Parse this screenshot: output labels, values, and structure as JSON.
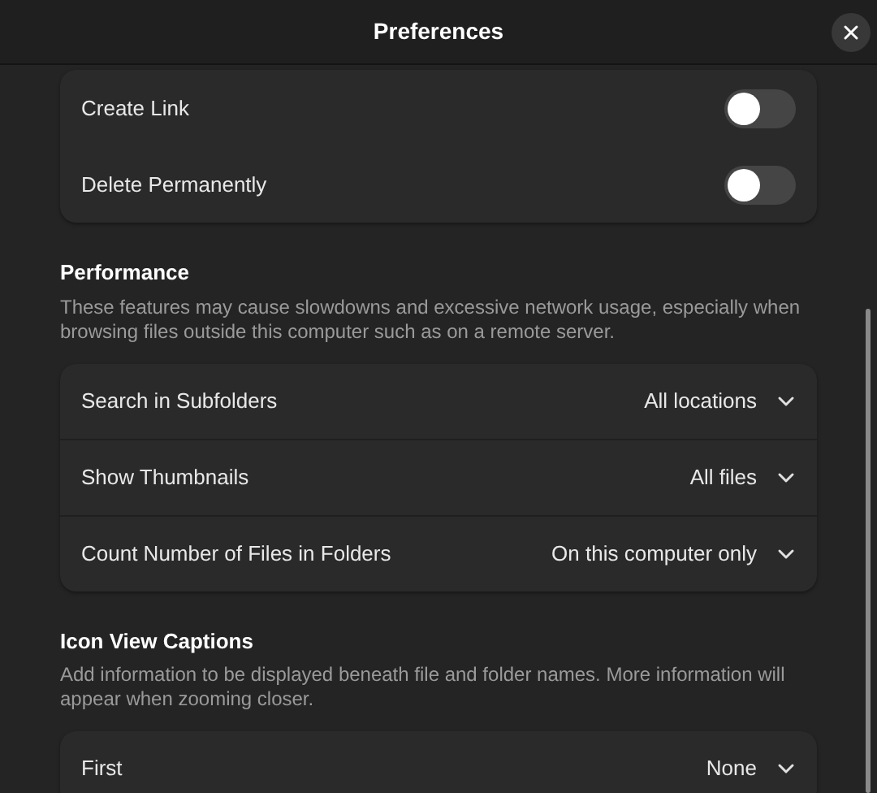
{
  "window": {
    "title": "Preferences"
  },
  "toggles": [
    {
      "label": "Create Link",
      "on": false
    },
    {
      "label": "Delete Permanently",
      "on": false
    }
  ],
  "sections": [
    {
      "title": "Performance",
      "description": "These features may cause slowdowns and excessive network usage, especially when browsing files outside this computer such as on a remote server.",
      "rows": [
        {
          "label": "Search in Subfolders",
          "value": "All locations"
        },
        {
          "label": "Show Thumbnails",
          "value": "All files"
        },
        {
          "label": "Count Number of Files in Folders",
          "value": "On this computer only"
        }
      ]
    },
    {
      "title": "Icon View Captions",
      "description": "Add information to be displayed beneath file and folder names. More information will appear when zooming closer.",
      "rows": [
        {
          "label": "First",
          "value": "None"
        }
      ]
    }
  ]
}
